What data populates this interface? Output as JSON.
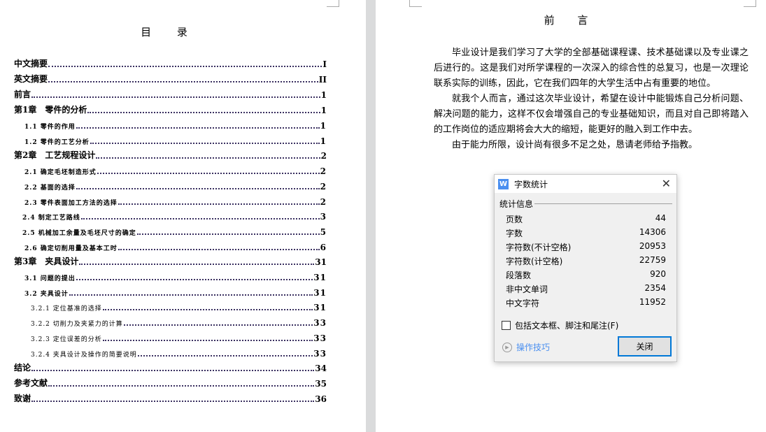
{
  "toc": {
    "title": "目 录",
    "items": [
      {
        "label": "中文摘要",
        "page": "I",
        "level": 1
      },
      {
        "label": "英文摘要",
        "page": "II",
        "level": 1
      },
      {
        "label": "前言",
        "page": "1",
        "level": 1
      },
      {
        "label": "第1章　零件的分析",
        "page": "1",
        "level": 1
      },
      {
        "label": "1.1 零件的作用",
        "page": "1",
        "level": 2
      },
      {
        "label": "1.2 零件的工艺分析",
        "page": "1",
        "level": 2
      },
      {
        "label": "第2章　工艺规程设计",
        "page": "2",
        "level": 1
      },
      {
        "label": "2.1 确定毛坯制造形式",
        "page": "2",
        "level": 2
      },
      {
        "label": "2.2 基面的选择",
        "page": "2",
        "level": 2
      },
      {
        "label": "2.3 零件表面加工方法的选择",
        "page": "2",
        "level": 2
      },
      {
        "label": "2.4 制定工艺路线",
        "page": "3",
        "level": 2
      },
      {
        "label": "2.5 机械加工余量及毛坯尺寸的确定",
        "page": "5",
        "level": 2
      },
      {
        "label": "2.6 确定切削用量及基本工时",
        "page": "6",
        "level": 2
      },
      {
        "label": "第3章　夹具设计",
        "page": "31",
        "level": 1
      },
      {
        "label": "3.1 问题的提出",
        "page": "31",
        "level": 2
      },
      {
        "label": "3.2 夹具设计",
        "page": "31",
        "level": 2
      },
      {
        "label": "3.2.1 定位基准的选择",
        "page": "31",
        "level": 3
      },
      {
        "label": "3.2.2 切削力及夹紧力的计算",
        "page": "33",
        "level": 3
      },
      {
        "label": "3.2.3 定位误差的分析",
        "page": "33",
        "level": 3
      },
      {
        "label": "3.2.4 夹具设计及操作的简要说明",
        "page": "33",
        "level": 3
      },
      {
        "label": "结论",
        "page": "34",
        "level": 1
      },
      {
        "label": "参考文献",
        "page": "35",
        "level": 1
      },
      {
        "label": "致谢",
        "page": "36",
        "level": 1
      }
    ]
  },
  "preface": {
    "title": "前 言",
    "paragraphs": [
      "毕业设计是我们学习了大学的全部基础课程课、技术基础课以及专业课之后进行的。这是我们对所学课程的一次深入的综合性的总复习，也是一次理论联系实际的训练，因此，它在我们四年的大学生活中占有重要的地位。",
      "就我个人而言，通过这次毕业设计，希望在设计中能锻炼自己分析问题、解决问题的能力，这样不仅会增强自己的专业基础知识，而且对自己即将踏入的工作岗位的适应期将会大大的缩短，能更好的融入到工作中去。",
      "由于能力所限，设计尚有很多不足之处，恳请老师给予指教。"
    ]
  },
  "dialog": {
    "title": "字数统计",
    "section": "统计信息",
    "stats": [
      {
        "label": "页数",
        "value": "44"
      },
      {
        "label": "字数",
        "value": "14306"
      },
      {
        "label": "字符数(不计空格)",
        "value": "20953"
      },
      {
        "label": "字符数(计空格)",
        "value": "22759"
      },
      {
        "label": "段落数",
        "value": "920"
      },
      {
        "label": "非中文单词",
        "value": "2354"
      },
      {
        "label": "中文字符",
        "value": "11952"
      }
    ],
    "checkbox_label": "包括文本框、脚注和尾注(F)",
    "checkbox_checked": false,
    "tips_label": "操作技巧",
    "close_label": "关闭",
    "app_icon": "W",
    "accent": "#0078d7"
  }
}
